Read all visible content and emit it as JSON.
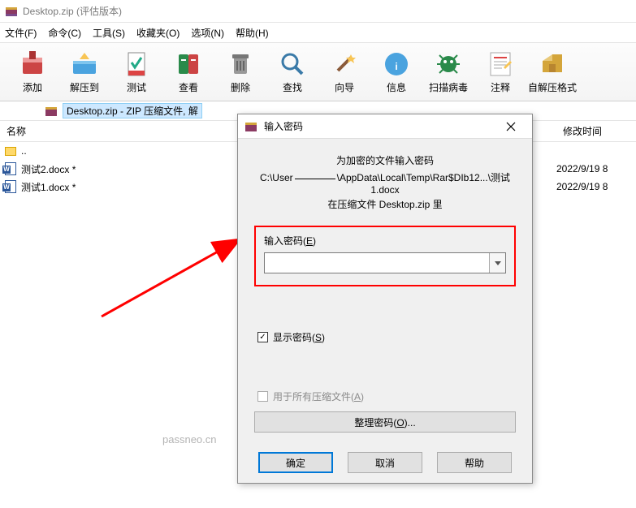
{
  "titlebar": {
    "title": "Desktop.zip (评估版本)"
  },
  "menu": {
    "file": "文件(F)",
    "cmd": "命令(C)",
    "tools": "工具(S)",
    "fav": "收藏夹(O)",
    "opt": "选项(N)",
    "help": "帮助(H)"
  },
  "toolbar": {
    "add": "添加",
    "extract": "解压到",
    "test": "测试",
    "view": "查看",
    "delete": "删除",
    "find": "查找",
    "wizard": "向导",
    "info": "信息",
    "scan": "扫描病毒",
    "comment": "注释",
    "sfx": "自解压格式"
  },
  "pathbar": {
    "text": "Desktop.zip - ZIP 压缩文件, 解"
  },
  "columns": {
    "name": "名称",
    "modified": "修改时间"
  },
  "rows": {
    "up": "..",
    "f1": {
      "name": "测试2.docx *",
      "mod": "2022/9/19 8"
    },
    "f2": {
      "name": "测试1.docx *",
      "mod": "2022/9/19 8"
    }
  },
  "dialog": {
    "title": "输入密码",
    "msg": "为加密的文件输入密码",
    "path_prefix": "C:\\User",
    "path_suffix": "\\AppData\\Local\\Temp\\Rar$DIb12...\\测试1.docx",
    "in_archive": "在压缩文件 Desktop.zip 里",
    "pw_label_pre": "输入密码(",
    "pw_label_key": "E",
    "pw_label_post": ")",
    "pw_value": "",
    "show_pre": "显示密码(",
    "show_key": "S",
    "show_post": ")",
    "all_pre": "用于所有压缩文件(",
    "all_key": "A",
    "all_post": ")",
    "org_pre": "整理密码(",
    "org_key": "O",
    "org_post": ")...",
    "ok": "确定",
    "cancel": "取消",
    "help": "帮助"
  },
  "watermark": "passneo.cn"
}
